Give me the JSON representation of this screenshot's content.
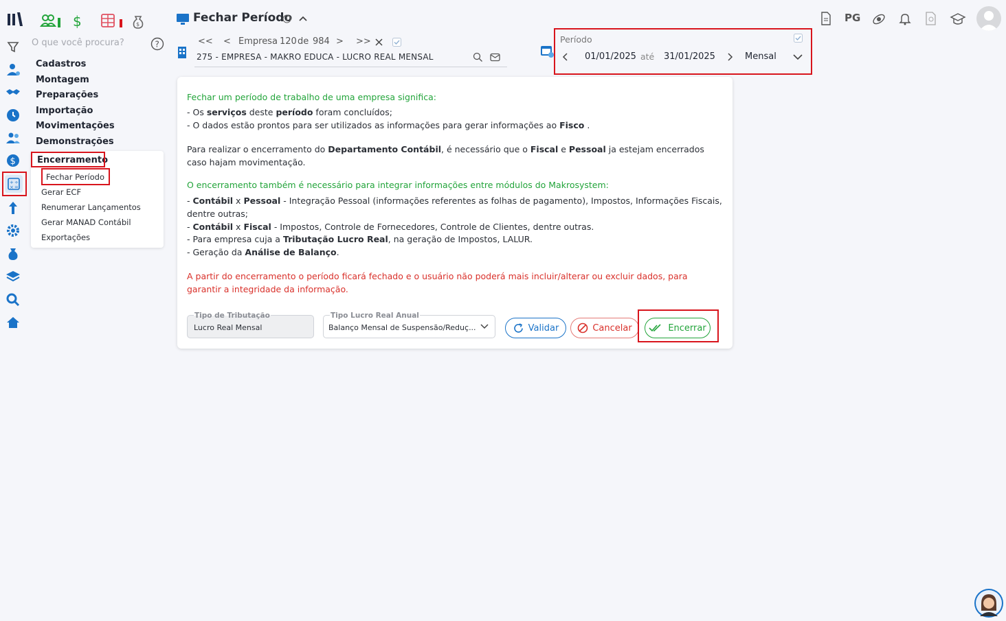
{
  "header": {
    "title": "Fechar Período"
  },
  "search": {
    "placeholder": "O que você procura?"
  },
  "top_right": {
    "pg_label": "PG"
  },
  "menu": {
    "items": [
      "Cadastros",
      "Montagem",
      "Preparações",
      "Importação",
      "Movimentações",
      "Demonstrações",
      "Encerramento"
    ],
    "submenu": [
      "Fechar Período",
      "Gerar ECF",
      "Renumerar Lançamentos",
      "Gerar MANAD Contábil",
      "Exportações"
    ]
  },
  "empresa": {
    "first": "<<",
    "prev": "<",
    "label": "Empresa",
    "index": "120",
    "de": "de",
    "total": "984",
    "next": ">",
    "last": ">>",
    "name": "275 - EMPRESA - MAKRO EDUCA - LUCRO REAL MENSAL"
  },
  "periodo": {
    "label": "Período",
    "start": "01/01/2025",
    "ate": "até",
    "end": "31/01/2025",
    "mode": "Mensal"
  },
  "content": {
    "intro_heading": "Fechar um período de trabalho de uma empresa significa:",
    "b1_a": "- Os ",
    "b1_b": "serviços",
    "b1_c": " deste ",
    "b1_d": "período",
    "b1_e": " foram concluídos;",
    "b2_a": "- O dados estão prontos para ser utilizados as informações para gerar informações ao ",
    "b2_b": "Fisco",
    "b2_c": " .",
    "p2_a": "Para realizar o encerramento do ",
    "p2_b": "Departamento Contábil",
    "p2_c": ", é necessário que o ",
    "p2_d": "Fiscal",
    "p2_e": " e ",
    "p2_f": "Pessoal",
    "p2_g": " ja estejam encerrados caso hajam movimentação.",
    "h2": "O encerramento também é necessário para integrar informações entre módulos do Makrosystem:",
    "l1_a": "- ",
    "l1_b": "Contábil",
    "l1_c": " x ",
    "l1_d": "Pessoal",
    "l1_e": " - Integração Pessoal (informações referentes as folhas de pagamento), Impostos, Informações Fiscais, dentre outras;",
    "l2_a": "- ",
    "l2_b": "Contábil",
    "l2_c": " x ",
    "l2_d": "Fiscal",
    "l2_e": " - Impostos, Controle de Fornecedores, Controle de Clientes, dentre outras.",
    "l3_a": "- Para empresa cuja a ",
    "l3_b": "Tributação Lucro Real",
    "l3_c": ", na geração de Impostos, LALUR.",
    "l4_a": "- Geração da ",
    "l4_b": "Análise de Balanço",
    "l4_c": ".",
    "warning": "A partir do encerramento o período ficará fechado e o usuário não poderá mais incluir/alterar ou excluir dados, para garantir a integridade da informação."
  },
  "form": {
    "tipo_trib_label": "Tipo de Tributação",
    "tipo_trib_value": "Lucro Real Mensal",
    "tipo_lucro_label": "Tipo Lucro Real Anual",
    "tipo_lucro_value": "Balanço Mensal de Suspensão/Reduç..."
  },
  "buttons": {
    "validar": "Validar",
    "cancelar": "Cancelar",
    "encerrar": "Encerrar"
  },
  "colors": {
    "accent_blue": "#1a73c8",
    "green": "#22a43a",
    "red": "#d9302a",
    "highlight_red": "#d8141c"
  }
}
